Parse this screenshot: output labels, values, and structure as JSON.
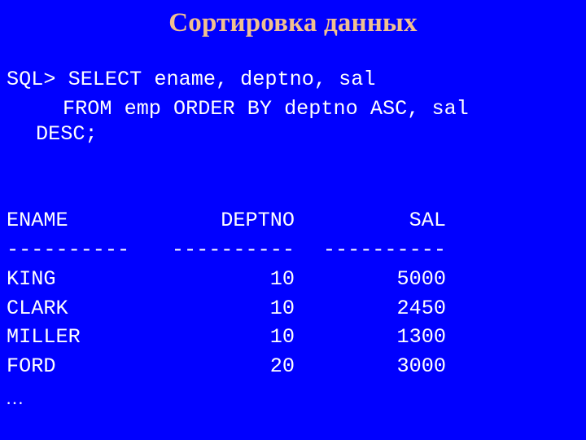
{
  "slide": {
    "title": "Сортировка данных",
    "background_color": "#0000ff",
    "title_color": "#f0c090"
  },
  "query": {
    "line1": "SQL> SELECT ename, deptno, sal",
    "line2": "FROM emp ORDER BY deptno ASC, sal",
    "line3": "DESC;"
  },
  "result": {
    "headers": [
      "ENAME",
      "DEPTNO",
      "SAL"
    ],
    "separators": [
      "----------",
      "----------",
      "----------"
    ],
    "rows": [
      [
        "KING",
        "10",
        "5000"
      ],
      [
        "CLARK",
        "10",
        "2450"
      ],
      [
        "MILLER",
        "10",
        "1300"
      ],
      [
        "FORD",
        "20",
        "3000"
      ]
    ],
    "continuation": "…"
  }
}
